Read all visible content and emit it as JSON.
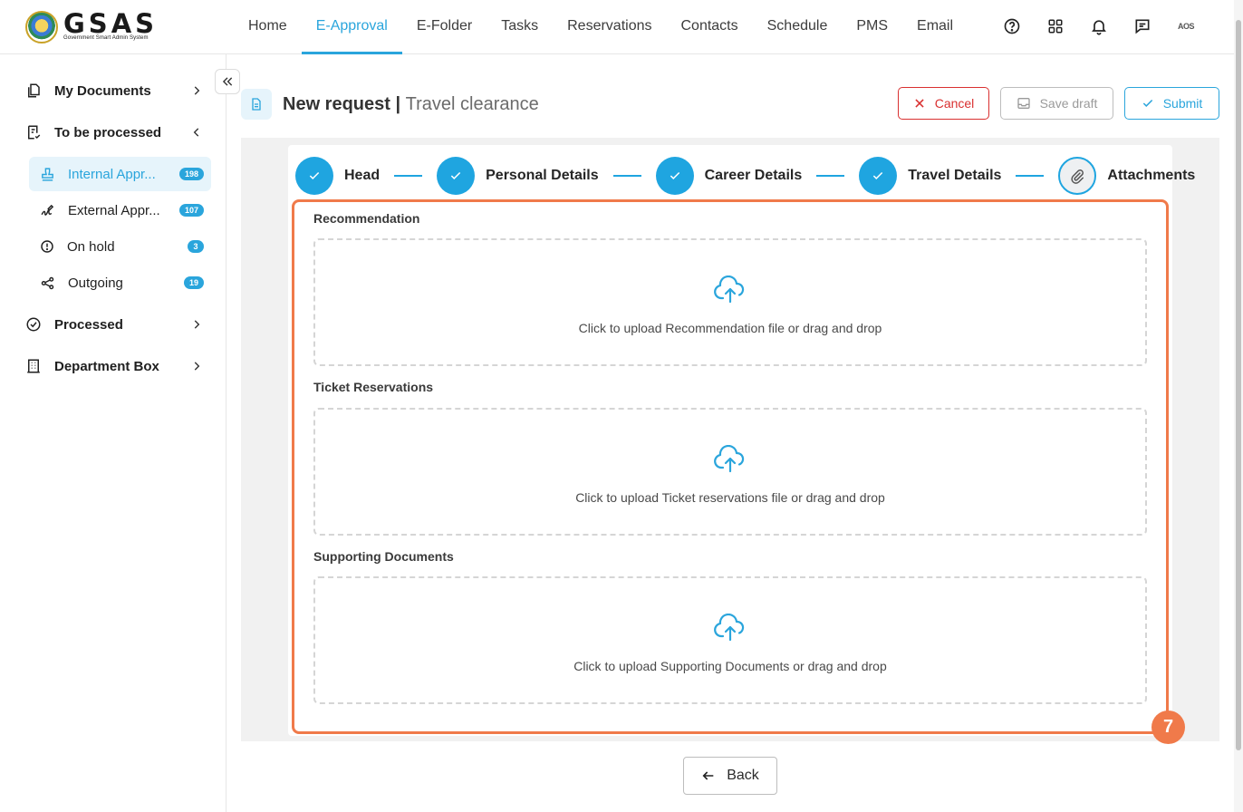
{
  "app": {
    "logo_name": "GSAS",
    "logo_subtitle": "Government Smart Admin System"
  },
  "nav": {
    "items": [
      {
        "label": "Home"
      },
      {
        "label": "E-Approval"
      },
      {
        "label": "E-Folder"
      },
      {
        "label": "Tasks"
      },
      {
        "label": "Reservations"
      },
      {
        "label": "Contacts"
      },
      {
        "label": "Schedule"
      },
      {
        "label": "PMS"
      },
      {
        "label": "Email"
      }
    ],
    "active_index": 1,
    "avatar_initials": "AOS"
  },
  "icons": {
    "help": "help-icon",
    "apps": "apps-grid-icon",
    "notifications": "bell-icon",
    "messages": "chat-icon"
  },
  "sidebar": {
    "groups": {
      "my_documents": "My Documents",
      "to_be_processed": "To be processed",
      "processed": "Processed",
      "department_box": "Department Box"
    },
    "sub_items": [
      {
        "label": "Internal Approvals",
        "count": "198"
      },
      {
        "label": "External Approvals",
        "count": "107"
      },
      {
        "label": "On hold",
        "count": "3"
      },
      {
        "label": "Outgoing",
        "count": "19"
      }
    ],
    "display": {
      "internal": "Internal Appr...",
      "external": "External Appr..."
    }
  },
  "header": {
    "title": "New request",
    "separator": "|",
    "subtitle": "Travel clearance",
    "cancel_label": "Cancel",
    "draft_label": "Save draft",
    "submit_label": "Submit"
  },
  "stepper": {
    "steps": [
      {
        "label": "Head",
        "state": "done"
      },
      {
        "label": "Personal Details",
        "state": "done"
      },
      {
        "label": "Career Details",
        "state": "done"
      },
      {
        "label": "Travel Details",
        "state": "done"
      },
      {
        "label": "Attachments",
        "state": "current"
      }
    ]
  },
  "attachments": [
    {
      "label": "Recommendation",
      "hint": "Click to upload Recommendation file or drag and drop"
    },
    {
      "label": "Ticket Reservations",
      "hint": "Click to upload Ticket reservations file or drag and drop"
    },
    {
      "label": "Supporting Documents",
      "hint": "Click to upload Supporting Documents or drag and drop"
    }
  ],
  "annotation": {
    "step_number": "7",
    "color": "#f07a4a"
  },
  "footer": {
    "back_label": "Back"
  },
  "colors": {
    "accent": "#2aa5dc",
    "danger": "#d93030",
    "muted": "#9a9a9a"
  }
}
